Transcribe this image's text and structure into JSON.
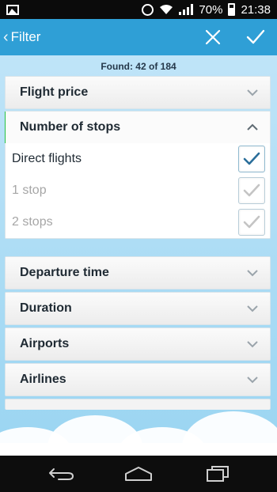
{
  "status_bar": {
    "battery": "70%",
    "time": "21:38",
    "icons": [
      "picture-icon",
      "alarm-icon",
      "wifi-icon",
      "signal-icon",
      "battery-icon"
    ]
  },
  "app_bar": {
    "back_glyph": "‹",
    "title": "Filter",
    "actions": [
      "close-icon",
      "check-icon"
    ]
  },
  "results": {
    "found_text": "Found: 42 of 184"
  },
  "filters": {
    "flight_price": {
      "label": "Flight price",
      "expanded": false
    },
    "number_of_stops": {
      "label": "Number of stops",
      "expanded": true,
      "options": [
        {
          "label": "Direct flights",
          "checked": true,
          "enabled": true
        },
        {
          "label": "1 stop",
          "checked": true,
          "enabled": false
        },
        {
          "label": "2 stops",
          "checked": true,
          "enabled": false
        }
      ]
    },
    "departure_time": {
      "label": "Departure time",
      "expanded": false
    },
    "duration": {
      "label": "Duration",
      "expanded": false
    },
    "airports": {
      "label": "Airports",
      "expanded": false
    },
    "airlines": {
      "label": "Airlines",
      "expanded": false
    }
  },
  "colors": {
    "app_bar": "#2f9fd6",
    "accent_green": "#27c142",
    "check_active": "#2a6e9a",
    "check_disabled": "#c4c4c4",
    "background_sky": "#a9dbf4"
  },
  "nav_bar": {
    "buttons": [
      "back-nav-icon",
      "home-nav-icon",
      "recent-apps-icon"
    ]
  }
}
